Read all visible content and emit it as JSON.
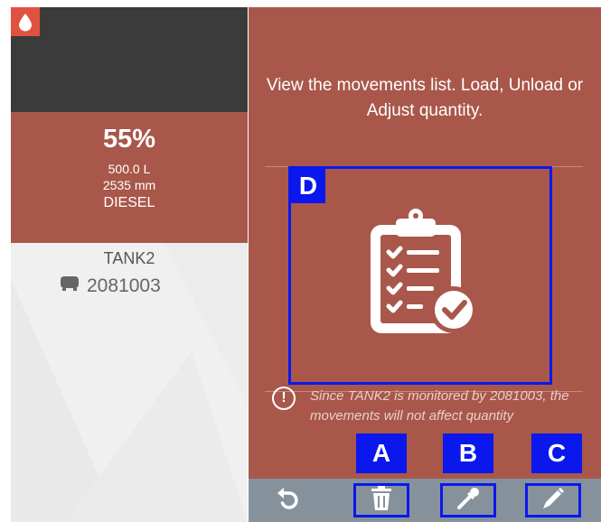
{
  "tank": {
    "percent": "55%",
    "volume": "500.0 L",
    "level": "2535 mm",
    "fuel": "DIESEL",
    "name": "TANK2",
    "device_id": "2081003"
  },
  "panel": {
    "description": "View the movements list. Load, Unload or Adjust quantity.",
    "info_text": "Since TANK2 is monitored by 2081003, the movements will not affect quantity"
  },
  "markers": {
    "a": "A",
    "b": "B",
    "c": "C",
    "d": "D"
  },
  "icons": {
    "drop": "drop-icon",
    "tank": "tank-icon",
    "clipboard": "clipboard-check-icon",
    "undo": "undo-icon",
    "trash": "trash-icon",
    "pipette": "pipette-icon",
    "pencil": "pencil-icon",
    "info": "info-icon"
  },
  "colors": {
    "accent": "#a9574a",
    "marker": "#0a18ee",
    "drop_bg": "#e0523f"
  }
}
